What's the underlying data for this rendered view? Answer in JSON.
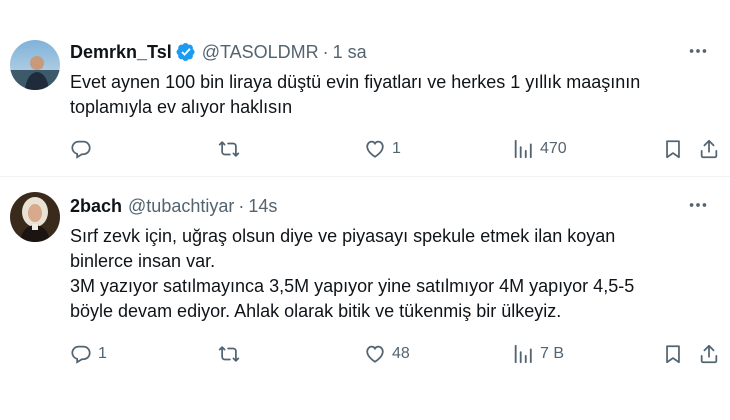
{
  "tweets": [
    {
      "display_name": "Demrkn_Tsl",
      "verified": true,
      "handle": "@TASOLDMR",
      "separator": "·",
      "time": "1 sa",
      "lines": [
        "Evet aynen 100 bin liraya düştü evin fiyatları ve herkes 1 yıllık maaşının",
        "toplamıyla ev alıyor haklısın"
      ],
      "replies": "",
      "retweets": "",
      "likes": "1",
      "views": "470"
    },
    {
      "display_name": "2bach",
      "verified": false,
      "handle": "@tubachtiyar",
      "separator": "·",
      "time": "14s",
      "lines": [
        "Sırf zevk için, uğraş olsun diye ve piyasayı spekule etmek ilan koyan",
        "binlerce insan var.",
        "3M yazıyor satılmayınca 3,5M yapıyor yine satılmıyor 4M yapıyor 4,5-5",
        "böyle devam ediyor. Ahlak olarak bitik ve tükenmiş bir ülkeyiz."
      ],
      "replies": "1",
      "retweets": "",
      "likes": "48",
      "views": "7 B"
    }
  ],
  "colors": {
    "text_primary": "#0f1419",
    "text_secondary": "#536471",
    "verified_blue": "#1d9bf0",
    "divider": "#eff3f4"
  },
  "icons": [
    "more-icon",
    "reply-icon",
    "retweet-icon",
    "like-icon",
    "views-icon",
    "bookmark-icon",
    "share-icon",
    "verified-badge-icon"
  ]
}
